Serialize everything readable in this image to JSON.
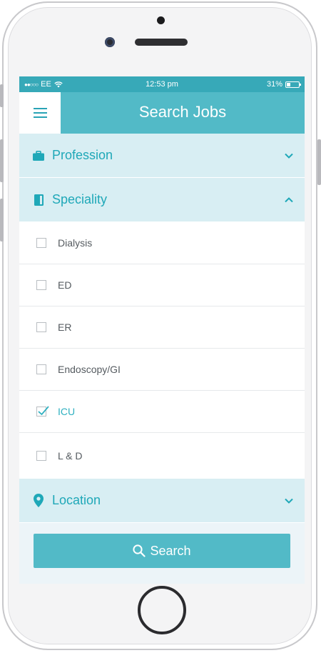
{
  "status_bar": {
    "signal_dots": "●●○○○",
    "carrier": "EE",
    "time": "12:53 pm",
    "battery_percent": "31%",
    "battery_level": 0.31
  },
  "header": {
    "title": "Search Jobs",
    "menu_icon": "hamburger-menu-icon"
  },
  "sections": {
    "profession": {
      "label": "Profession",
      "icon": "briefcase-icon",
      "expanded": false
    },
    "speciality": {
      "label": "Speciality",
      "icon": "book-icon",
      "expanded": true
    },
    "location": {
      "label": "Location",
      "icon": "map-pin-icon",
      "expanded": false
    }
  },
  "speciality_items": [
    {
      "label": "Dialysis",
      "checked": false
    },
    {
      "label": "ED",
      "checked": false
    },
    {
      "label": "ER",
      "checked": false
    },
    {
      "label": "Endoscopy/GI",
      "checked": false
    },
    {
      "label": "ICU",
      "checked": true
    },
    {
      "label": "L & D",
      "checked": false
    }
  ],
  "search_button": {
    "label": "Search",
    "icon": "search-icon"
  },
  "colors": {
    "accent": "#52bac7",
    "status_bar": "#37a9b8",
    "section_bg": "#d8eef3",
    "text_teal": "#1fa8b8"
  }
}
